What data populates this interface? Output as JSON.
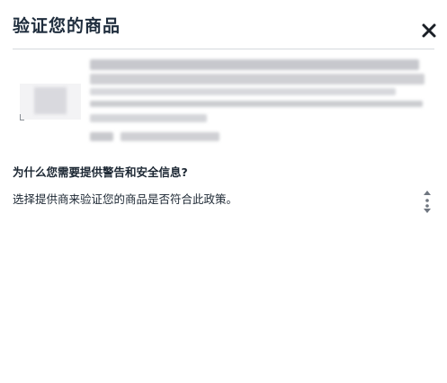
{
  "dialog": {
    "title": "验证您的商品",
    "close_icon": "close-icon"
  },
  "product": {
    "image_icon": "product-image"
  },
  "section": {
    "heading": "为什么您需要提供警告和安全信息?",
    "body": "选择提供商来验证您的商品是否符合此政策。"
  },
  "scroll_icon": "scroll-handle-icon",
  "colors": {
    "title": "#1f2d3d",
    "text": "#1c2733",
    "divider": "#d6d9dd",
    "blur": "#c9cace"
  }
}
